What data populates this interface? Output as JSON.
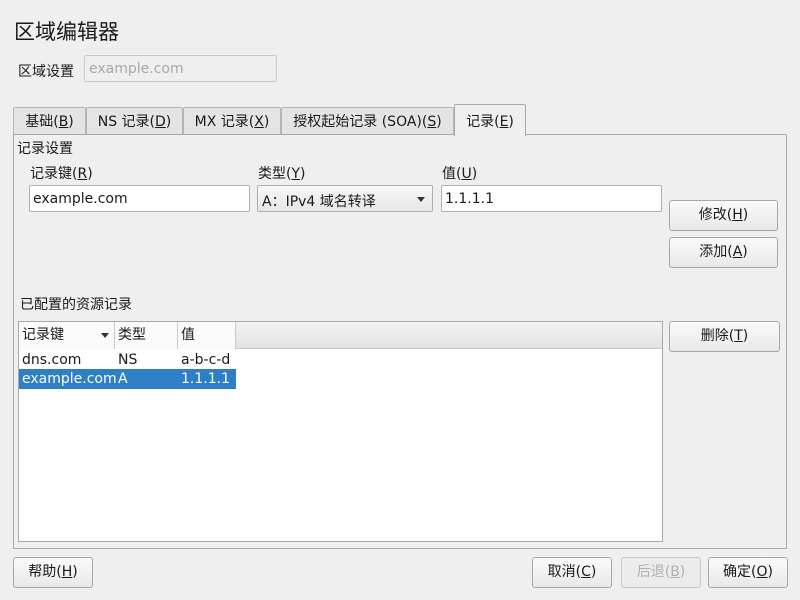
{
  "window": {
    "title": "区域编辑器"
  },
  "zone": {
    "label": "区域设置",
    "placeholder": "example.com"
  },
  "tabs": [
    {
      "label": "基础",
      "mnemonic": "B"
    },
    {
      "label": "NS 记录",
      "mnemonic": "D"
    },
    {
      "label": "MX 记录",
      "mnemonic": "X"
    },
    {
      "label": "授权起始记录 (SOA)",
      "mnemonic": "S"
    },
    {
      "label": "记录",
      "mnemonic": "E"
    }
  ],
  "record_settings": {
    "group_title": "记录设置",
    "key": {
      "label": "记录键",
      "mnemonic": "R",
      "value": "example.com"
    },
    "type": {
      "label": "类型",
      "mnemonic": "Y",
      "value": "A：IPv4 域名转译"
    },
    "value": {
      "label": "值",
      "mnemonic": "U",
      "value": "1.1.1.1"
    }
  },
  "buttons": {
    "modify": {
      "label": "修改",
      "mnemonic": "H"
    },
    "add": {
      "label": "添加",
      "mnemonic": "A"
    },
    "delete": {
      "label": "删除",
      "mnemonic": "T"
    },
    "help": {
      "label": "帮助",
      "mnemonic": "H"
    },
    "cancel": {
      "label": "取消",
      "mnemonic": "C"
    },
    "back": {
      "label": "后退",
      "mnemonic": "B"
    },
    "ok": {
      "label": "确定",
      "mnemonic": "O"
    }
  },
  "records": {
    "title": "已配置的资源记录",
    "columns": [
      "记录键",
      "类型",
      "值"
    ],
    "rows": [
      {
        "key": "dns.com",
        "type": "NS",
        "value": "a-b-c-d",
        "selected": false
      },
      {
        "key": "example.com",
        "type": "A",
        "value": "1.1.1.1",
        "selected": true
      }
    ]
  },
  "colors": {
    "selection": "#2f7fc7",
    "background": "#efefef"
  }
}
